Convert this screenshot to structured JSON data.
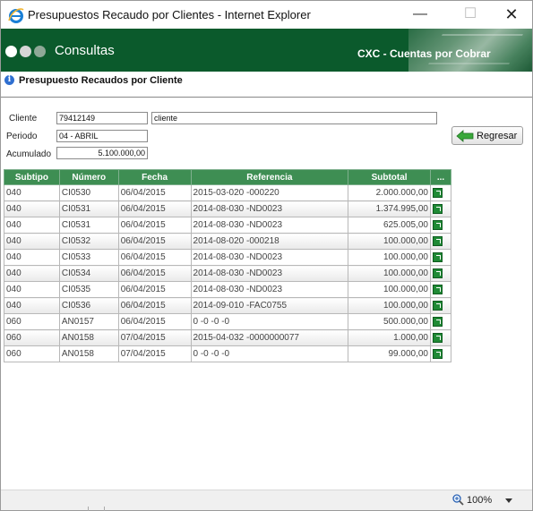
{
  "window": {
    "title": "Presupuestos Recaudo por Clientes - Internet Explorer",
    "minimize_glyph": "—",
    "maximize_glyph": "☐",
    "close_glyph": "✕"
  },
  "banner": {
    "section": "Consultas",
    "module": "CXC - Cuentas por Cobrar",
    "color": "#0b5a2c"
  },
  "page": {
    "title": "Presupuesto Recaudos por Cliente",
    "info_icon": "info-icon"
  },
  "form": {
    "cliente_label": "Cliente",
    "cliente_value": "79412149",
    "cliente_nombre": "cliente",
    "periodo_label": "Periodo",
    "periodo_value": "04 - ABRIL",
    "acumulado_label": "Acumulado",
    "acumulado_value": "5.100.000,00",
    "back_label": "Regresar",
    "back_icon": "arrow-left-icon"
  },
  "table": {
    "header_color": "#3e8e53",
    "columns": [
      "Subtipo",
      "Número",
      "Fecha",
      "Referencia",
      "Subtotal",
      "..."
    ],
    "rows": [
      {
        "subtipo": "040",
        "numero": "CI0530",
        "fecha": "06/04/2015",
        "referencia": "2015-03-020 -000220",
        "subtotal": "2.000.000,00"
      },
      {
        "subtipo": "040",
        "numero": "CI0531",
        "fecha": "06/04/2015",
        "referencia": "2014-08-030 -ND0023",
        "subtotal": "1.374.995,00"
      },
      {
        "subtipo": "040",
        "numero": "CI0531",
        "fecha": "06/04/2015",
        "referencia": "2014-08-030 -ND0023",
        "subtotal": "625.005,00"
      },
      {
        "subtipo": "040",
        "numero": "CI0532",
        "fecha": "06/04/2015",
        "referencia": "2014-08-020 -000218",
        "subtotal": "100.000,00"
      },
      {
        "subtipo": "040",
        "numero": "CI0533",
        "fecha": "06/04/2015",
        "referencia": "2014-08-030 -ND0023",
        "subtotal": "100.000,00"
      },
      {
        "subtipo": "040",
        "numero": "CI0534",
        "fecha": "06/04/2015",
        "referencia": "2014-08-030 -ND0023",
        "subtotal": "100.000,00"
      },
      {
        "subtipo": "040",
        "numero": "CI0535",
        "fecha": "06/04/2015",
        "referencia": "2014-08-030 -ND0023",
        "subtotal": "100.000,00"
      },
      {
        "subtipo": "040",
        "numero": "CI0536",
        "fecha": "06/04/2015",
        "referencia": "2014-09-010 -FAC0755",
        "subtotal": "100.000,00"
      },
      {
        "subtipo": "060",
        "numero": "AN0157",
        "fecha": "06/04/2015",
        "referencia": "0 -0 -0 -0",
        "subtotal": "500.000,00"
      },
      {
        "subtipo": "060",
        "numero": "AN0158",
        "fecha": "07/04/2015",
        "referencia": "2015-04-032 -0000000077",
        "subtotal": "1.000,00"
      },
      {
        "subtipo": "060",
        "numero": "AN0158",
        "fecha": "07/04/2015",
        "referencia": "0 -0 -0 -0",
        "subtotal": "99.000,00"
      }
    ]
  },
  "statusbar": {
    "zoom": "100%"
  }
}
